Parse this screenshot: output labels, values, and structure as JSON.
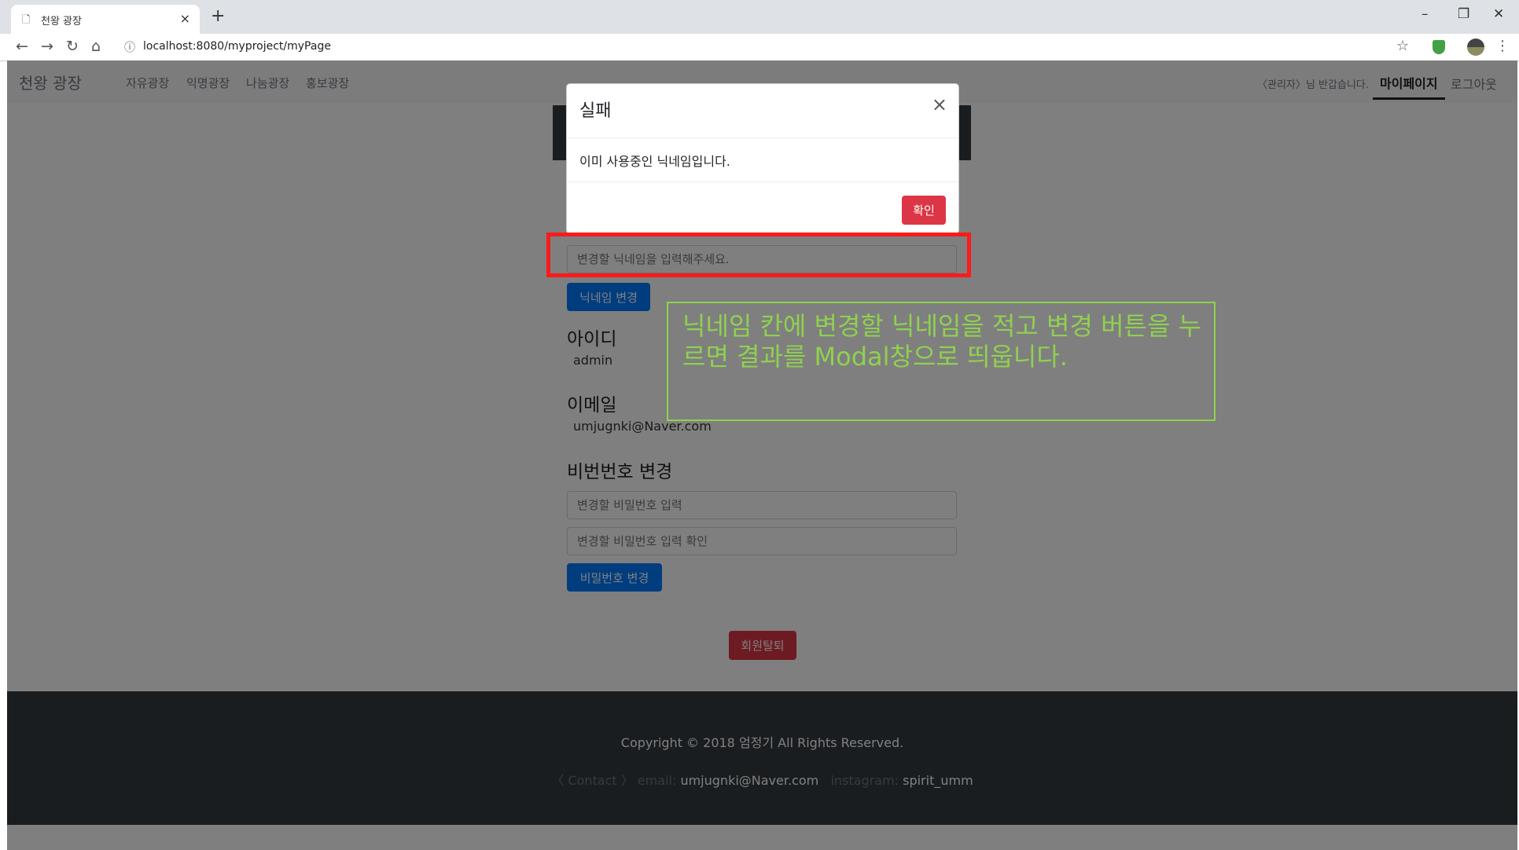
{
  "browser": {
    "tab_title": "천왕 광장",
    "tab_close": "×",
    "new_tab": "+",
    "url": "localhost:8080/myproject/myPage",
    "window_controls": {
      "minimize": "–",
      "maximize": "❐",
      "close": "✕"
    }
  },
  "site": {
    "brand": "천왕 광장",
    "menu": [
      "자유광장",
      "익명광장",
      "나눔광장",
      "홍보광장"
    ],
    "greeting": "〈관리자〉님 반갑습니다.",
    "mypage": "마이페이지",
    "logout": "로그아웃"
  },
  "mypage": {
    "nickname_placeholder": "변경할 닉네임을 입력해주세요.",
    "nickname_button": "닉네임 변경",
    "id_label": "아이디",
    "id_value": "admin",
    "email_label": "이메일",
    "email_value": "umjugnki@Naver.com",
    "password_heading": "비번번호 변경",
    "password_placeholder": "변경할 비밀번호 입력",
    "password_confirm_placeholder": "변경할 비밀번호 입력 확인",
    "password_button": "비밀번호 변경",
    "withdraw_button": "회원탈퇴"
  },
  "footer": {
    "copyright": "Copyright © 2018 엄정기 All Rights Reserved.",
    "contact_label": "〈 Contact 〉 email: ",
    "email": "umjugnki@Naver.com",
    "instagram_label": "instagram: ",
    "instagram": "spirit_umm"
  },
  "modal": {
    "title": "실패",
    "close": "×",
    "message": "이미 사용중인 닉네임입니다.",
    "confirm": "확인"
  },
  "annotation": {
    "text": "닉네임 칸에 변경할 닉네임을 적고 변경 버튼을 누르면 결과를 Modal창으로 띄웁니다.",
    "highlight_color": "#ff1a1a",
    "text_color": "#8fd14f"
  },
  "colors": {
    "primary": "#007bff",
    "danger": "#dc3545",
    "footer": "#343a40"
  }
}
